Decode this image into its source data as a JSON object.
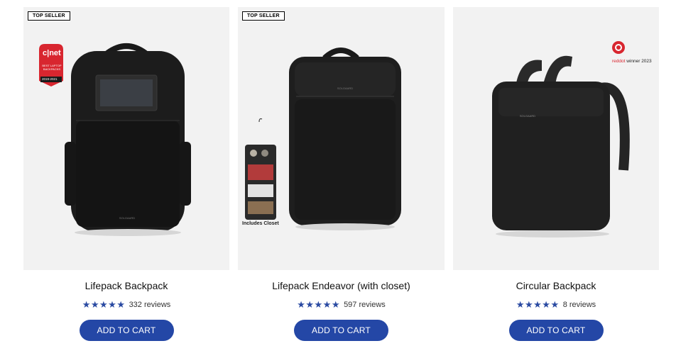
{
  "products": [
    {
      "badge": "TOP SELLER",
      "title": "Lifepack Backpack",
      "stars": "★★★★★",
      "rating": 5,
      "reviews": "332 reviews",
      "button": "ADD TO CART",
      "award_line1": "c|net",
      "award_line2": "BEST LAPTOP BACKPACKS",
      "award_line3": "2019-2021",
      "brand": "SOLGAARD"
    },
    {
      "badge": "TOP SELLER",
      "title": "Lifepack Endeavor (with closet)",
      "stars": "★★★★★",
      "rating": 5,
      "reviews": "597 reviews",
      "button": "ADD TO CART",
      "closet_label": "Includes Closet",
      "brand": "SOLGAARD"
    },
    {
      "title": "Circular Backpack",
      "stars": "★★★★★",
      "rating": 5,
      "reviews": "8 reviews",
      "button": "ADD TO CART",
      "award_red": "reddot",
      "award_rest": " winner 2023",
      "brand": "SOLGAARD"
    }
  ],
  "colors": {
    "accent": "#2447a6",
    "star": "#2a4aa2",
    "card_bg": "#f2f2f2",
    "award_red": "#d8262f"
  }
}
